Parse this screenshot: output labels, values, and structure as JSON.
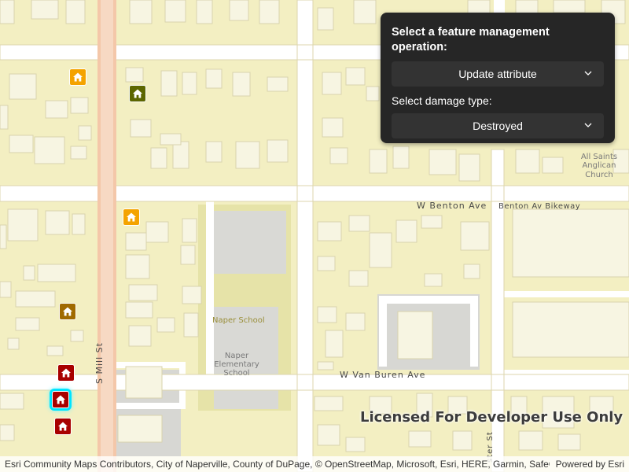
{
  "panel": {
    "title": "Select a feature management operation:",
    "operation_selected": "Update attribute",
    "damage_label": "Select damage type:",
    "damage_selected": "Destroyed"
  },
  "map": {
    "streets": {
      "mill": "S Mill St",
      "benton": "W Benton Ave",
      "benton_bikeway": "Benton Av Bikeway",
      "van_buren": "W Van Buren Ave",
      "bottom_right_street": "ster St"
    },
    "places": {
      "naper_school": "Naper School",
      "naper_elem_1": "Naper",
      "naper_elem_2": "Elementary",
      "naper_elem_3": "School",
      "church_1": "All Saints",
      "church_2": "Anglican",
      "church_3": "Church"
    },
    "markers": [
      {
        "damage": "Affected",
        "color": "#f4a300"
      },
      {
        "damage": "Minor",
        "color": "#5c6600"
      },
      {
        "damage": "Affected",
        "color": "#f4a300"
      },
      {
        "damage": "Major",
        "color": "#a06a00"
      },
      {
        "damage": "Destroyed",
        "color": "#a80000"
      },
      {
        "damage": "Destroyed",
        "color": "#a80000",
        "selected": true
      },
      {
        "damage": "Destroyed",
        "color": "#a80000"
      }
    ]
  },
  "watermark": "Licensed For Developer Use Only",
  "attribution": {
    "text": "Esri Community Maps Contributors, City of Naperville, County of DuPage, © OpenStreetMap, Microsoft, Esri, HERE, Garmin, SafeGr...",
    "powered": "Powered by Esri"
  }
}
